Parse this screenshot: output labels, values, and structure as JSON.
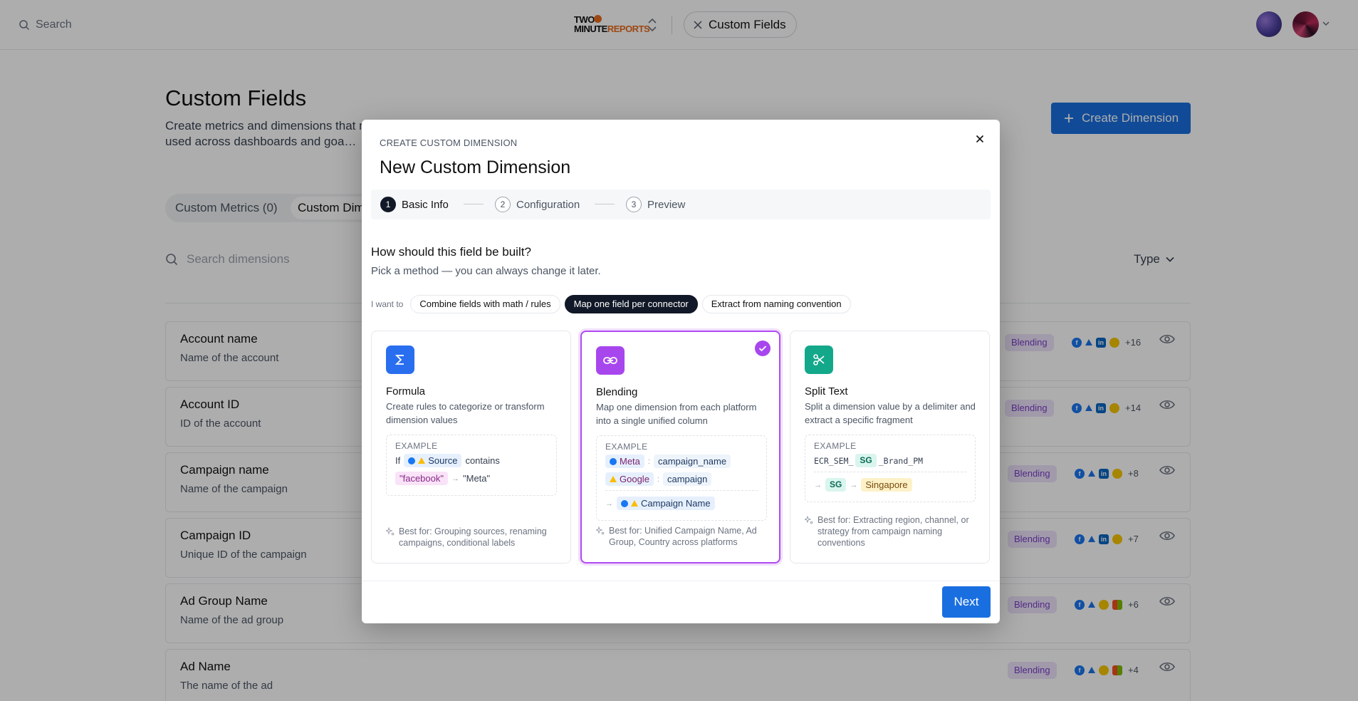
{
  "topbar": {
    "search_placeholder": "Search",
    "logo_line1": "TWO",
    "logo_line2a": "MINUTE",
    "logo_line2b": "REPORTS",
    "tab_label": "Custom Fields"
  },
  "page": {
    "title": "Custom Fields",
    "description": "Create metrics and dimensions that r… be used across dashboards and goa…",
    "create_button": "Create Dimension",
    "segments": [
      "Custom Metrics (0)",
      "Custom Dim"
    ],
    "search_placeholder": "Search dimensions",
    "type_filter": "Type"
  },
  "rows": [
    {
      "name": "Account name",
      "desc": "Name of the account",
      "badge": "Blending",
      "more": "+16",
      "icons": [
        "fb",
        "google",
        "li",
        "sc"
      ]
    },
    {
      "name": "Account ID",
      "desc": "ID of the account",
      "badge": "Blending",
      "more": "+14",
      "icons": [
        "fb",
        "google",
        "li",
        "sc"
      ]
    },
    {
      "name": "Campaign name",
      "desc": "Name of the campaign",
      "badge": "Blending",
      "more": "+8",
      "icons": [
        "fb",
        "google",
        "li",
        "sc"
      ]
    },
    {
      "name": "Campaign ID",
      "desc": "Unique ID of the campaign",
      "badge": "Blending",
      "more": "+7",
      "icons": [
        "fb",
        "google",
        "li",
        "sc"
      ]
    },
    {
      "name": "Ad Group Name",
      "desc": "Name of the ad group",
      "badge": "Blending",
      "more": "+6",
      "icons": [
        "fb",
        "google",
        "sc",
        "ms"
      ]
    },
    {
      "name": "Ad Name",
      "desc": "The name of the ad",
      "badge": "Blending",
      "more": "+4",
      "icons": [
        "fb",
        "google",
        "sc",
        "ms"
      ]
    }
  ],
  "modal": {
    "kicker": "CREATE CUSTOM DIMENSION",
    "title": "New Custom Dimension",
    "steps": [
      {
        "num": "1",
        "label": "Basic Info",
        "active": true
      },
      {
        "num": "2",
        "label": "Configuration",
        "active": false
      },
      {
        "num": "3",
        "label": "Preview",
        "active": false
      }
    ],
    "question": "How should this field be built?",
    "question_sub": "Pick a method — you can always change it later.",
    "i_want_to": "I want to",
    "pills": [
      "Combine fields with math / rules",
      "Map one field per connector",
      "Extract from naming convention"
    ],
    "active_pill": 1,
    "example_label": "EXAMPLE",
    "cards": [
      {
        "title": "Formula",
        "desc": "Create rules to categorize or transform dimension values",
        "best_for": "Best for: Grouping sources, renaming campaigns, conditional labels",
        "icon": "sigma-icon",
        "color": "#2a6ef0",
        "example": {
          "if": "If",
          "source": "Source",
          "contains": "contains",
          "value": "\"facebook\"",
          "result": "\"Meta\""
        }
      },
      {
        "title": "Blending",
        "desc": "Map one dimension from each platform into a single unified column",
        "best_for": "Best for: Unified Campaign Name, Ad Group, Country across platforms",
        "icon": "link-icon",
        "color": "#a846ee",
        "selected": true,
        "example": {
          "p1": "Meta",
          "f1": "campaign_name",
          "p2": "Google",
          "f2": "campaign",
          "result": "Campaign Name"
        }
      },
      {
        "title": "Split Text",
        "desc": "Split a dimension value by a delimiter and extract a specific fragment",
        "best_for": "Best for: Extracting region, channel, or strategy from campaign naming conventions",
        "icon": "scissors-icon",
        "color": "#14a88a",
        "example": {
          "pre": "ECR_SEM_",
          "token": "SG",
          "post": "_Brand_PM",
          "out_token": "SG",
          "result": "Singapore"
        }
      }
    ],
    "next_button": "Next"
  }
}
